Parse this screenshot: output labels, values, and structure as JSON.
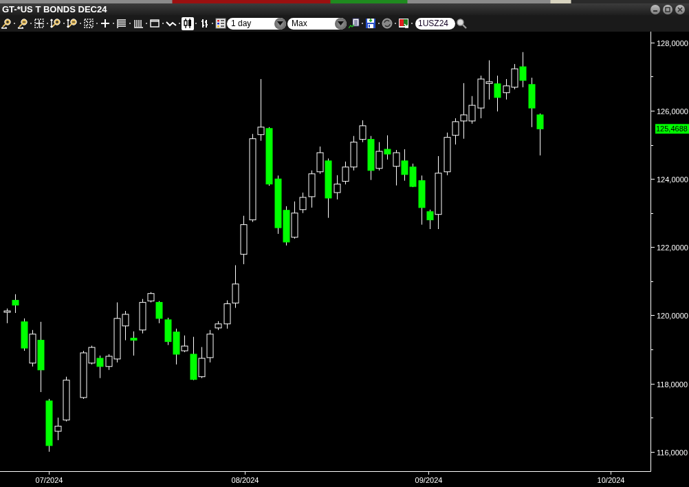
{
  "window": {
    "title": "GT-*US T BONDS DEC24"
  },
  "toolbar": {
    "tools": [
      {
        "kind": "zoom-in",
        "selected": false
      },
      {
        "kind": "zoom-out",
        "selected": false
      },
      {
        "kind": "fit",
        "selected": false
      },
      {
        "kind": "v-zoom-in",
        "selected": false
      },
      {
        "kind": "v-zoom-out",
        "selected": false
      },
      {
        "kind": "reset",
        "selected": false
      },
      {
        "kind": "crosshair",
        "selected": false
      },
      {
        "kind": "hgrid",
        "selected": false
      },
      {
        "kind": "vgrid",
        "selected": false
      },
      {
        "kind": "frame",
        "selected": false
      },
      {
        "kind": "line",
        "selected": false
      },
      {
        "kind": "candle",
        "selected": true
      },
      {
        "kind": "ohlc",
        "selected": false
      },
      {
        "kind": "legend",
        "selected": false
      }
    ],
    "dropdowns": [
      {
        "value": "1 day"
      },
      {
        "value": "Max"
      }
    ],
    "actions": [
      {
        "kind": "indicator"
      },
      {
        "kind": "save"
      },
      {
        "kind": "refresh"
      },
      {
        "kind": "export"
      }
    ],
    "symbol": {
      "value": "1USZ24"
    }
  },
  "chart": {
    "y_axis_labels": [
      "128,0000",
      "126,0000",
      "124,0000",
      "122,0000",
      "120,0000",
      "118,0000",
      "116,0000"
    ],
    "x_axis_labels": [
      "07/2024",
      "08/2024",
      "09/2024",
      "10/2024"
    ],
    "last_price": "125,4688"
  }
}
